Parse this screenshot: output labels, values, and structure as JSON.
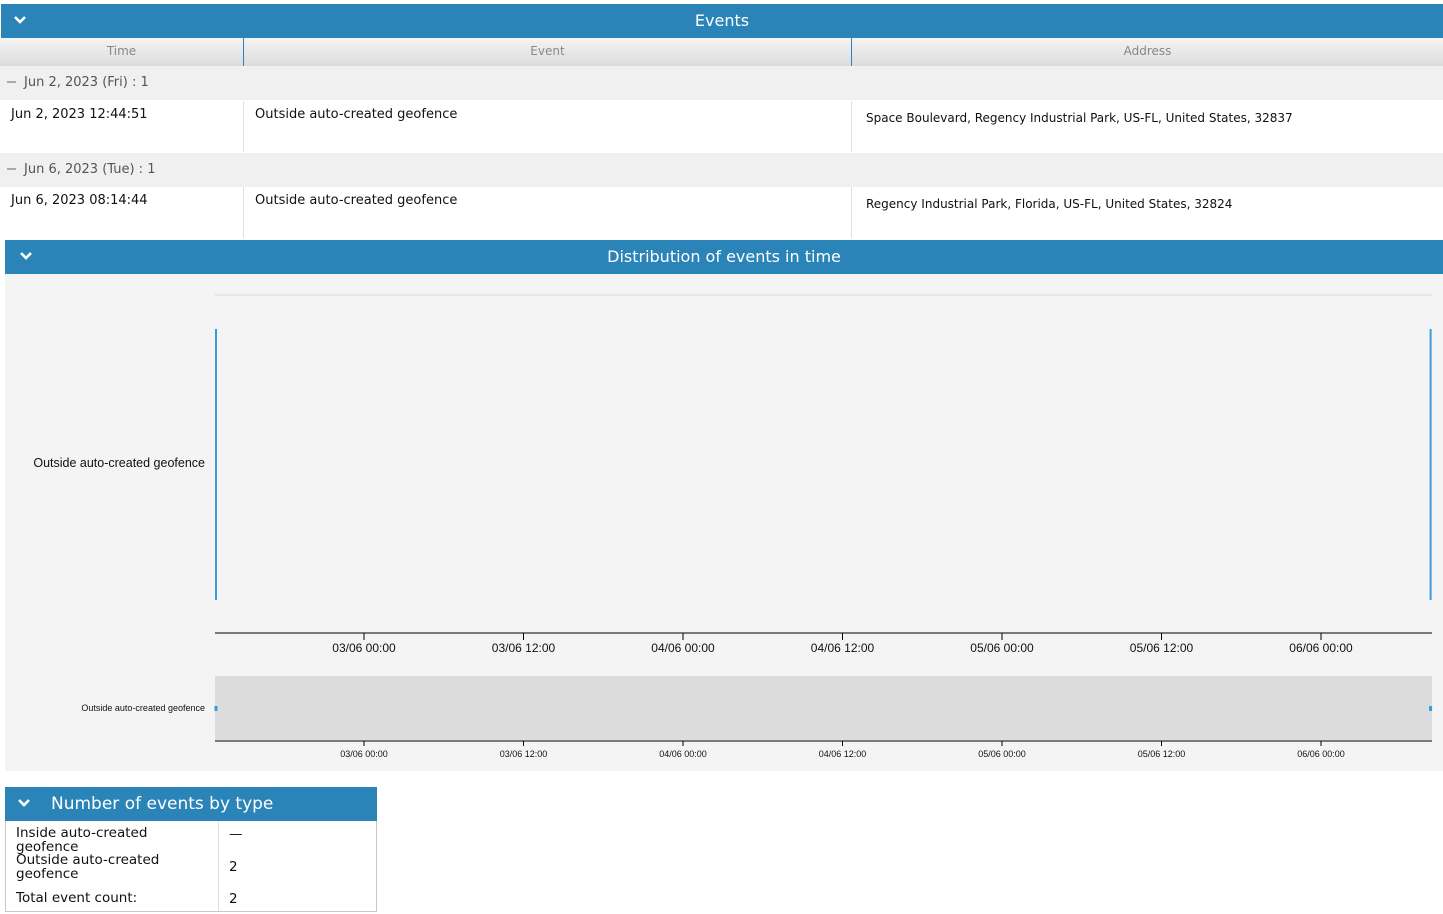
{
  "events_panel": {
    "title": "Events",
    "columns": [
      "Time",
      "Event",
      "Address"
    ],
    "groups": [
      {
        "label": "Jun 2, 2023 (Fri) : 1",
        "rows": [
          {
            "time": "Jun 2, 2023 12:44:51",
            "event": "Outside auto-created geofence",
            "address": "Space Boulevard, Regency Industrial Park, US-FL, United States, 32837"
          }
        ]
      },
      {
        "label": "Jun 6, 2023 (Tue) : 1",
        "rows": [
          {
            "time": "Jun 6, 2023 08:14:44",
            "event": "Outside auto-created geofence",
            "address": "Regency Industrial Park, Florida, US-FL, United States, 32824"
          }
        ]
      }
    ]
  },
  "distribution_panel": {
    "title": "Distribution of events in time"
  },
  "chart_data": {
    "type": "scatter",
    "categories": [
      "Outside auto-created geofence"
    ],
    "x_tick_labels": [
      "03/06 00:00",
      "03/06 12:00",
      "04/06 00:00",
      "04/06 12:00",
      "05/06 00:00",
      "05/06 12:00",
      "06/06 00:00"
    ],
    "overview_category_label": "Outside auto-created geofence",
    "series": [
      {
        "values": [
          {
            "x": "2023-06-02 12:44:51",
            "y": "Outside auto-created geofence"
          },
          {
            "x": "2023-06-06 08:14:44",
            "y": "Outside auto-created geofence"
          }
        ]
      }
    ],
    "grid": false,
    "colors": {
      "marker": "#3a9bd9",
      "axis": "#000000",
      "overview_band": "#dcdcdc"
    }
  },
  "count_panel": {
    "title": "Number of events by type",
    "rows": [
      {
        "label": "Inside auto-created geofence",
        "value": "—"
      },
      {
        "label": "Outside auto-created geofence",
        "value": "2"
      },
      {
        "label": "Total event count:",
        "value": "2"
      }
    ]
  },
  "colors": {
    "header_bg": "#2a84b8",
    "header_text": "#ffffff",
    "group_bg": "#f0f0f0",
    "chart_bg": "#f4f4f4"
  },
  "icons": {
    "collapse": "chevron-down-icon",
    "group_toggle": "minus-icon"
  }
}
